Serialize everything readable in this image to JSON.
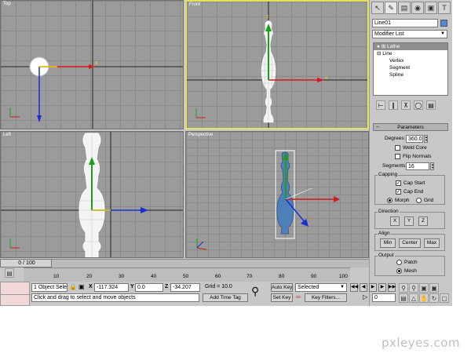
{
  "viewports": {
    "top": {
      "label": "Top"
    },
    "front": {
      "label": "Front"
    },
    "left": {
      "label": "Left"
    },
    "perspective": {
      "label": "Perspective"
    }
  },
  "axis_labels": {
    "x": "x",
    "y": "y",
    "z": "z"
  },
  "command_panel": {
    "tab_icons": [
      "cursor-icon",
      "modify-icon",
      "hierarchy-icon",
      "motion-icon",
      "display-icon",
      "utilities-icon"
    ],
    "object_name": "Line01",
    "object_color": "#4b8ad8",
    "modifier_list": "Modifier List",
    "stack": [
      {
        "label": "Lathe"
      },
      {
        "label": "Line"
      },
      {
        "label": "Vertex"
      },
      {
        "label": "Segment"
      },
      {
        "label": "Spline"
      }
    ],
    "parameters": {
      "title": "Parameters",
      "degrees_label": "Degrees:",
      "degrees_value": "360.0",
      "weld_core": "Weld Core",
      "flip_normals": "Flip Normals",
      "segments_label": "Segments:",
      "segments_value": "16",
      "capping": "Capping",
      "cap_start": "Cap Start",
      "cap_end": "Cap End",
      "morph": "Morph",
      "grid": "Grid",
      "direction": "Direction",
      "dir_x": "X",
      "dir_y": "Y",
      "dir_z": "Z",
      "align": "Align",
      "min": "Min",
      "center": "Center",
      "max": "Max",
      "output": "Output",
      "patch": "Patch",
      "mesh": "Mesh"
    }
  },
  "timeline": {
    "slider": "0 / 100",
    "ticks": [
      "10",
      "20",
      "30",
      "40",
      "50",
      "60",
      "70",
      "80",
      "90",
      "100"
    ]
  },
  "status": {
    "selection": "1 Object Sele",
    "prompt": "Click and drag to select and move objects",
    "x_label": "X",
    "x_value": "-117.324",
    "y_label": "Y",
    "y_value": "0.0",
    "z_label": "Z",
    "z_value": "-34.207",
    "grid": "Grid = 10.0",
    "add_time_tag": "Add Time Tag",
    "auto_key": "Auto Key",
    "set_key": "Set Key",
    "selected": "Selected",
    "key_filters": "Key Filters...",
    "frame": "0"
  },
  "watermark": "pxleyes.com"
}
